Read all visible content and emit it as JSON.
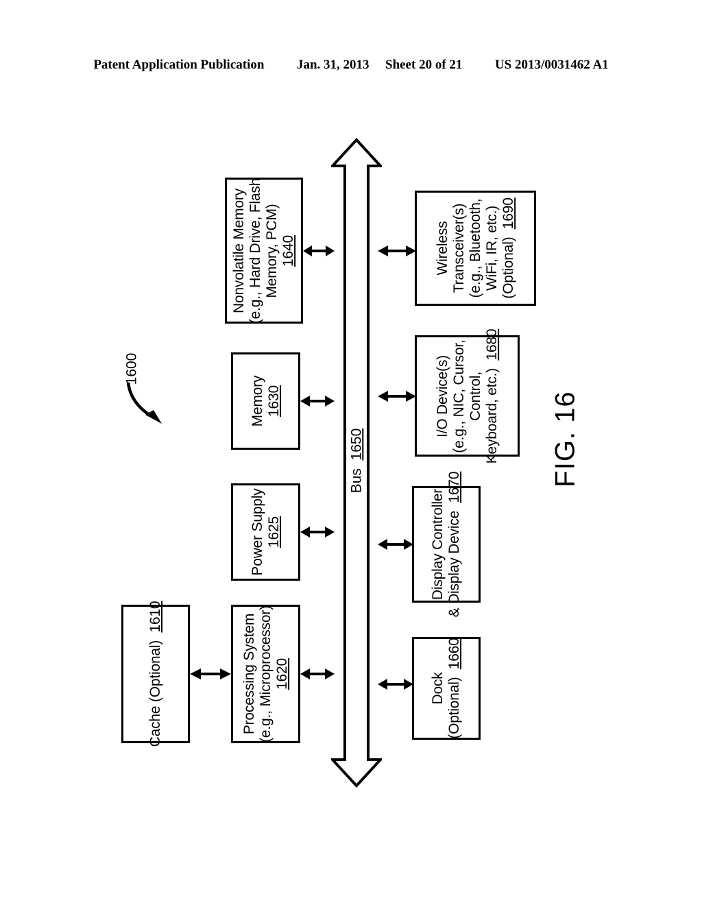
{
  "header": {
    "publication": "Patent Application Publication",
    "date": "Jan. 31, 2013",
    "sheet": "Sheet 20 of 21",
    "doc_number": "US 2013/0031462 A1"
  },
  "figure": {
    "caption": "FIG. 16",
    "system_ref": "1600",
    "bus": {
      "label": "Bus",
      "ref": "1650"
    },
    "nodes": {
      "cache": {
        "lines": [
          "Cache (Optional)"
        ],
        "ref": "1610"
      },
      "processing_system": {
        "lines": [
          "Processing System",
          "(e.g., Microprocessor)"
        ],
        "ref": "1620"
      },
      "power_supply": {
        "lines": [
          "Power Supply"
        ],
        "ref": "1625"
      },
      "memory": {
        "lines": [
          "Memory"
        ],
        "ref": "1630"
      },
      "nonvolatile_memory": {
        "lines": [
          "Nonvolatile Memory",
          "(e.g., Hard Drive, Flash",
          "Memory, PCM)"
        ],
        "ref": "1640"
      },
      "dock": {
        "lines": [
          "Dock",
          "(Optional)"
        ],
        "ref": "1660"
      },
      "display_controller": {
        "lines": [
          "Display Controller",
          "& Display Device"
        ],
        "ref": "1670"
      },
      "io_devices": {
        "lines": [
          "I/O Device(s)",
          "(e.g., NIC, Cursor,",
          "Control,",
          "Keyboard, etc.)"
        ],
        "ref": "1680"
      },
      "wireless_transceivers": {
        "lines": [
          "Wireless",
          "Transceiver(s)",
          "(e.g., Bluetooth,",
          "WiFi, IR, etc.)",
          "(Optional)"
        ],
        "ref": "1690"
      }
    }
  },
  "diagram_data": {
    "type": "block-diagram",
    "orientation": "rotated-90-ccw",
    "bus_connections": [
      "processing_system",
      "power_supply",
      "memory",
      "nonvolatile_memory",
      "dock",
      "display_controller",
      "io_devices",
      "wireless_transceivers"
    ],
    "direct_links": [
      {
        "from": "cache",
        "to": "processing_system",
        "bidirectional": true
      }
    ]
  }
}
